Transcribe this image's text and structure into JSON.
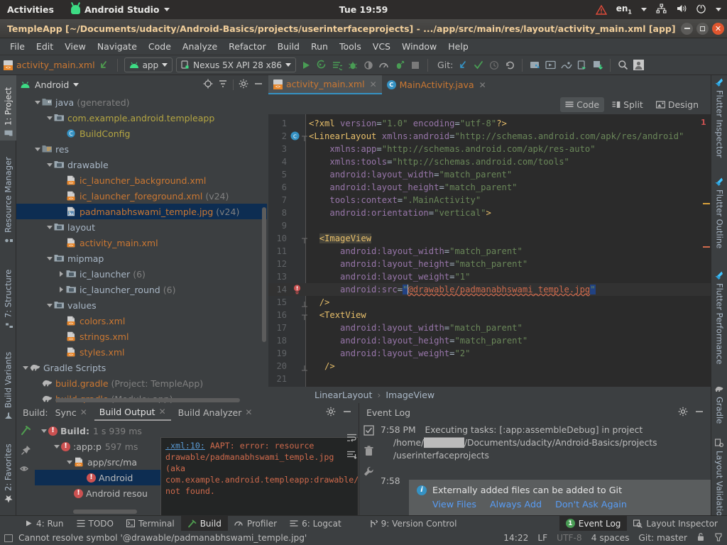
{
  "gnome": {
    "activities": "Activities",
    "app_name": "Android Studio",
    "clock": "Tue 19:59",
    "lang": "en",
    "lang_sub": "1",
    "icons": [
      "warning-triangle-icon",
      "network-icon",
      "volume-icon",
      "power-icon",
      "chevron-down-icon"
    ]
  },
  "window": {
    "title": "TempleApp [~/Documents/udacity/Android-Basics/projects/userinterfaceprojects] - .../app/src/main/res/layout/activity_main.xml [app]"
  },
  "menubar": {
    "items": [
      "File",
      "Edit",
      "View",
      "Navigate",
      "Code",
      "Analyze",
      "Refactor",
      "Build",
      "Run",
      "Tools",
      "VCS",
      "Window",
      "Help"
    ]
  },
  "toolbar": {
    "open_file": "activity_main.xml",
    "module_combo": "app",
    "device_combo": "Nexus 5X API 28 x86",
    "git_label": "Git:",
    "icons": [
      "back-arrow-icon",
      "run-icon",
      "debug-run-icon",
      "apply-changes-icon",
      "debug-icon",
      "attach-debugger-icon",
      "profiler-icon",
      "run-coverage-icon",
      "stop-icon",
      "update-project-icon",
      "commit-icon",
      "history-icon",
      "rollback-icon",
      "sdk-manager-icon",
      "avd-manager-icon",
      "device-file-explorer-icon",
      "layout-inspector-icon",
      "device-manager-icon",
      "search-icon",
      "profile-icon"
    ]
  },
  "left_rail": {
    "tabs": [
      {
        "label": "1: Project",
        "icon": "project-icon",
        "active": true
      },
      {
        "label": "Resource Manager",
        "icon": "resource-manager-icon",
        "active": false
      },
      {
        "label": "7: Structure",
        "icon": "structure-icon",
        "active": false
      },
      {
        "label": "Build Variants",
        "icon": "build-variants-icon",
        "active": false
      },
      {
        "label": "2: Favorites",
        "icon": "star-icon",
        "active": false
      }
    ]
  },
  "right_rail": {
    "tabs": [
      {
        "label": "Flutter Inspector",
        "icon": "flutter-icon"
      },
      {
        "label": "Flutter Outline",
        "icon": "flutter-icon"
      },
      {
        "label": "Flutter Performance",
        "icon": "flutter-icon"
      },
      {
        "label": "Gradle",
        "icon": "gradle-elephant-icon"
      },
      {
        "label": "Layout Validation",
        "icon": "layout-validation-icon"
      }
    ]
  },
  "project_panel": {
    "title": "Android",
    "header_icons": [
      "locate-icon",
      "collapse-all-icon",
      "gear-icon",
      "hide-icon"
    ],
    "tree": [
      {
        "indent": 1,
        "twist": "open",
        "icon": "java-folder-icon",
        "label": "java",
        "suffix": "(generated)",
        "color": "plain",
        "sel": false
      },
      {
        "indent": 2,
        "twist": "open",
        "icon": "package-icon",
        "label": "com.example.android.templeapp",
        "suffix": "",
        "color": "yellow",
        "sel": false
      },
      {
        "indent": 3,
        "twist": "none",
        "icon": "class-icon",
        "label": "BuildConfig",
        "suffix": "",
        "color": "yellow",
        "sel": false
      },
      {
        "indent": 1,
        "twist": "open",
        "icon": "res-folder-icon",
        "label": "res",
        "suffix": "",
        "color": "plain",
        "sel": false
      },
      {
        "indent": 2,
        "twist": "open",
        "icon": "folder-icon",
        "label": "drawable",
        "suffix": "",
        "color": "plain",
        "sel": false
      },
      {
        "indent": 3,
        "twist": "none",
        "icon": "xml-file-icon",
        "label": "ic_launcher_background.xml",
        "suffix": "",
        "color": "orange",
        "sel": false
      },
      {
        "indent": 3,
        "twist": "none",
        "icon": "xml-file-icon",
        "label": "ic_launcher_foreground.xml",
        "suffix": "(v24)",
        "color": "orange",
        "sel": false
      },
      {
        "indent": 3,
        "twist": "none",
        "icon": "image-file-icon",
        "label": "padmanabhswami_temple.jpg",
        "suffix": "(v24)",
        "color": "orange",
        "sel": true
      },
      {
        "indent": 2,
        "twist": "open",
        "icon": "folder-icon",
        "label": "layout",
        "suffix": "",
        "color": "plain",
        "sel": false
      },
      {
        "indent": 3,
        "twist": "none",
        "icon": "xml-file-icon",
        "label": "activity_main.xml",
        "suffix": "",
        "color": "orange",
        "sel": false
      },
      {
        "indent": 2,
        "twist": "open",
        "icon": "folder-icon",
        "label": "mipmap",
        "suffix": "",
        "color": "plain",
        "sel": false
      },
      {
        "indent": 3,
        "twist": "closed",
        "icon": "folder-icon",
        "label": "ic_launcher",
        "suffix": "(6)",
        "color": "plain",
        "sel": false
      },
      {
        "indent": 3,
        "twist": "closed",
        "icon": "folder-icon",
        "label": "ic_launcher_round",
        "suffix": "(6)",
        "color": "plain",
        "sel": false
      },
      {
        "indent": 2,
        "twist": "open",
        "icon": "folder-icon",
        "label": "values",
        "suffix": "",
        "color": "plain",
        "sel": false
      },
      {
        "indent": 3,
        "twist": "none",
        "icon": "xml-file-icon",
        "label": "colors.xml",
        "suffix": "",
        "color": "orange",
        "sel": false
      },
      {
        "indent": 3,
        "twist": "none",
        "icon": "xml-file-icon",
        "label": "strings.xml",
        "suffix": "",
        "color": "orange",
        "sel": false
      },
      {
        "indent": 3,
        "twist": "none",
        "icon": "xml-file-icon",
        "label": "styles.xml",
        "suffix": "",
        "color": "orange",
        "sel": false
      },
      {
        "indent": 0,
        "twist": "open",
        "icon": "gradle-elephant-icon",
        "label": "Gradle Scripts",
        "suffix": "",
        "color": "plain",
        "sel": false
      },
      {
        "indent": 1,
        "twist": "none",
        "icon": "gradle-elephant-icon",
        "label": "build.gradle",
        "suffix": "(Project: TempleApp)",
        "color": "orange",
        "sel": false
      },
      {
        "indent": 1,
        "twist": "none",
        "icon": "gradle-elephant-icon",
        "label": "build.gradle",
        "suffix": "(Module: app)",
        "color": "orange",
        "sel": false
      }
    ]
  },
  "editor": {
    "tabs": [
      {
        "label": "activity_main.xml",
        "icon": "xml-file-icon",
        "active": true
      },
      {
        "label": "MainActivity.java",
        "icon": "java-class-icon",
        "active": false
      }
    ],
    "modes": [
      {
        "label": "Code",
        "icon": "code-view-icon",
        "active": true
      },
      {
        "label": "Split",
        "icon": "split-view-icon",
        "active": false
      },
      {
        "label": "Design",
        "icon": "design-view-icon",
        "active": false
      }
    ],
    "breadcrumbs": [
      "LinearLayout",
      "ImageView"
    ],
    "error_count": "1",
    "lines": [
      {
        "n": "1",
        "html": "<span class=\"k-proc\">&lt;?xml </span><span class=\"k-attr\">version</span><span class=\"k-punct\">=</span><span class=\"k-val\">\"1.0\"</span> <span class=\"k-attr\">encoding</span><span class=\"k-punct\">=</span><span class=\"k-val\">\"utf-8\"</span><span class=\"k-proc\">?&gt;</span>"
      },
      {
        "n": "2",
        "html": "<span class=\"k-tag\">&lt;LinearLayout</span> <span class=\"k-attr\">xmlns:android</span><span class=\"k-punct\">=</span><span class=\"k-val\">\"http://schemas.android.com/apk/res/android\"</span>"
      },
      {
        "n": "3",
        "html": "    <span class=\"k-attr\">xmlns:app</span><span class=\"k-punct\">=</span><span class=\"k-val\">\"http://schemas.android.com/apk/res-auto\"</span>"
      },
      {
        "n": "4",
        "html": "    <span class=\"k-attr\">xmlns:tools</span><span class=\"k-punct\">=</span><span class=\"k-val\">\"http://schemas.android.com/tools\"</span>"
      },
      {
        "n": "5",
        "html": "    <span class=\"k-attr\">android:layout_width</span><span class=\"k-punct\">=</span><span class=\"k-val\">\"match_parent\"</span>"
      },
      {
        "n": "6",
        "html": "    <span class=\"k-attr\">android:layout_height</span><span class=\"k-punct\">=</span><span class=\"k-val\">\"match_parent\"</span>"
      },
      {
        "n": "7",
        "html": "    <span class=\"k-attr\">tools:context</span><span class=\"k-punct\">=</span><span class=\"k-val\">\".MainActivity\"</span>"
      },
      {
        "n": "8",
        "html": "    <span class=\"k-attr\">android:orientation</span><span class=\"k-punct\">=</span><span class=\"k-val\">\"vertical\"</span><span class=\"k-tag\">&gt;</span>"
      },
      {
        "n": "9",
        "html": ""
      },
      {
        "n": "10",
        "html": "  <span class=\"k-tag hl-box\">&lt;ImageView</span>"
      },
      {
        "n": "11",
        "html": "      <span class=\"k-attr\">android:layout_width</span><span class=\"k-punct\">=</span><span class=\"k-val\">\"match_parent\"</span>"
      },
      {
        "n": "12",
        "html": "      <span class=\"k-attr\">android:layout_height</span><span class=\"k-punct\">=</span><span class=\"k-val\">\"match_parent\"</span>"
      },
      {
        "n": "13",
        "html": "      <span class=\"k-attr\">android:layout_weight</span><span class=\"k-punct\">=</span><span class=\"k-val\">\"1\"</span>"
      },
      {
        "n": "14",
        "html": "      <span class=\"k-attr\">android:src</span><span class=\"k-punct\">=</span><span class=\"sel-q k-val\">\"</span><span class=\"caret-blk\"></span><span class=\"k-red\">@drawable/padmanabhswami_temple.jpg</span><span class=\"sel-q k-val\">\"</span>"
      },
      {
        "n": "15",
        "html": "  <span class=\"k-tag\">/&gt;</span>"
      },
      {
        "n": "16",
        "html": "  <span class=\"k-tag\">&lt;TextView</span>"
      },
      {
        "n": "17",
        "html": "      <span class=\"k-attr\">android:layout_width</span><span class=\"k-punct\">=</span><span class=\"k-val\">\"match_parent\"</span>"
      },
      {
        "n": "18",
        "html": "      <span class=\"k-attr\">android:layout_height</span><span class=\"k-punct\">=</span><span class=\"k-val\">\"match_parent\"</span>"
      },
      {
        "n": "19",
        "html": "      <span class=\"k-attr\">android:layout_weight</span><span class=\"k-punct\">=</span><span class=\"k-val\">\"2\"</span>"
      },
      {
        "n": "20",
        "html": "   <span class=\"k-tag\">/&gt;</span>"
      },
      {
        "n": "21",
        "html": ""
      }
    ]
  },
  "build_panel": {
    "label": "Build:",
    "tabs": [
      {
        "label": "Sync",
        "closable": true,
        "active": false
      },
      {
        "label": "Build Output",
        "closable": true,
        "active": true
      },
      {
        "label": "Build Analyzer",
        "closable": true,
        "active": false
      }
    ],
    "header_icons": [
      "gear-icon",
      "hide-icon"
    ],
    "side_icons": [
      "build-hammer-icon",
      "pin-icon",
      "eye-icon"
    ],
    "tree": [
      {
        "indent": 0,
        "twist": "open",
        "err": true,
        "label": "Build:",
        "bold": true,
        "time": "1 s 939 ms",
        "sel": false
      },
      {
        "indent": 1,
        "twist": "open",
        "err": true,
        "label": ":app:p",
        "bold": false,
        "time": "597 ms",
        "sel": false
      },
      {
        "indent": 2,
        "twist": "open",
        "err": false,
        "icon": "xml-file-icon",
        "label": "app/src/ma",
        "bold": false,
        "time": "",
        "sel": false
      },
      {
        "indent": 3,
        "twist": "none",
        "err": true,
        "label": "Android",
        "bold": false,
        "time": "",
        "sel": true
      },
      {
        "indent": 2,
        "twist": "none",
        "err": true,
        "label": "Android resou",
        "bold": false,
        "time": "",
        "sel": false
      }
    ],
    "tooltip": {
      "link": ".xml:10:",
      "text": " AAPT: error: resource drawable/padmanabhswami_temple.jpg (aka com.example.android.templeapp:drawable/padmanabhswami_temple.jpg) not found."
    }
  },
  "event_log": {
    "title": "Event Log",
    "header_icons": [
      "gear-icon",
      "hide-icon"
    ],
    "side_icons": [
      "mark-read-icon",
      "trash-icon",
      "wrench-icon"
    ],
    "entries": [
      {
        "time": "7:58 PM",
        "text": "Executing tasks: [:app:assembleDebug] in project"
      },
      {
        "time": "",
        "text": "/home/██████/Documents/udacity/Android-Basics/projects"
      },
      {
        "time": "",
        "text": "/userinterfaceprojects"
      },
      {
        "time": "7:58",
        "text": ""
      }
    ],
    "popup": {
      "message": "Externally added files can be added to Git",
      "actions": [
        "View Files",
        "Always Add",
        "Don't Ask Again"
      ]
    }
  },
  "tool_strip": {
    "left": [
      {
        "label": "4: Run",
        "icon": "run-icon",
        "active": false,
        "underline": "4"
      },
      {
        "label": "TODO",
        "icon": "todo-icon",
        "active": false,
        "underline": ""
      },
      {
        "label": "Terminal",
        "icon": "terminal-icon",
        "active": false,
        "underline": ""
      },
      {
        "label": "Build",
        "icon": "build-hammer-icon",
        "active": true,
        "underline": ""
      },
      {
        "label": "Profiler",
        "icon": "profiler-icon",
        "active": false,
        "underline": ""
      },
      {
        "label": "6: Logcat",
        "icon": "logcat-icon",
        "active": false,
        "underline": "6"
      },
      {
        "label": "9: Version Control",
        "icon": "version-control-icon",
        "active": false,
        "underline": "9"
      }
    ],
    "right": [
      {
        "label": "Event Log",
        "icon": "event-log-icon",
        "badge": "1",
        "active": true
      },
      {
        "label": "Layout Inspector",
        "icon": "layout-inspector-icon",
        "badge": "",
        "active": false
      }
    ]
  },
  "statusbar": {
    "message": "Cannot resolve symbol '@drawable/padmanabhswami_temple.jpg'",
    "position": "14:22",
    "line_sep": "LF",
    "encoding": "UTF-8",
    "indent": "4 spaces",
    "branch": "Git: master",
    "icons": [
      "lock-icon",
      "inspection-icon"
    ]
  },
  "colors": {
    "accent_blue": "#3592c4",
    "error_red": "#cc5151",
    "code_string": "#6a8759",
    "code_tag": "#e8bf6a",
    "code_attr": "#9876aa",
    "orange_file": "#cc7832",
    "selection": "#0d2d52",
    "editor_bg": "#2b2b2b",
    "panel_bg": "#3c3f41"
  }
}
